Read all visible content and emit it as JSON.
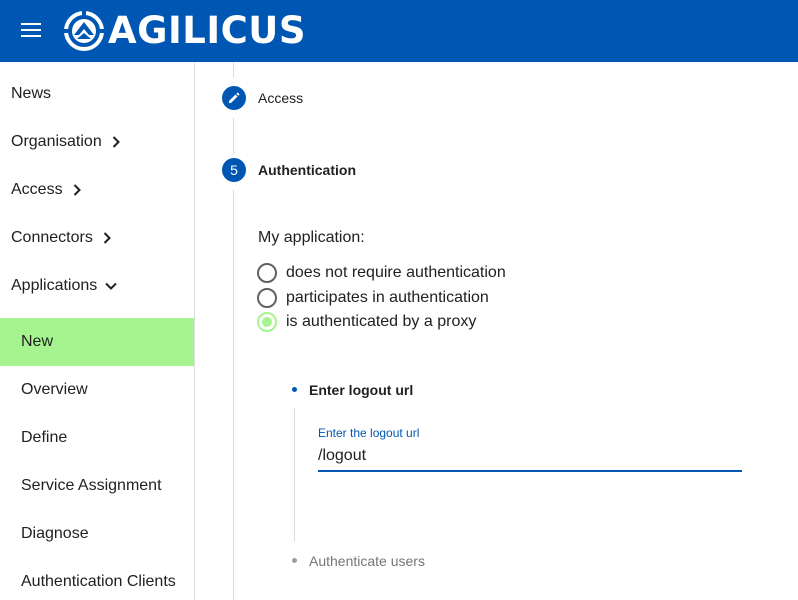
{
  "header": {
    "brand": "AGILICUS",
    "colors": {
      "bar": "#0057b3",
      "accent": "#a5f48f"
    }
  },
  "sidebar": {
    "items": [
      {
        "label": "News",
        "chevron": ""
      },
      {
        "label": "Organisation",
        "chevron": "chevron-right-icon"
      },
      {
        "label": "Access",
        "chevron": "chevron-right-icon"
      },
      {
        "label": "Connectors",
        "chevron": "chevron-right-icon"
      },
      {
        "label": "Applications",
        "chevron": "chevron-down-icon"
      },
      {
        "label": "New",
        "active": true
      },
      {
        "label": "Overview"
      },
      {
        "label": "Define"
      },
      {
        "label": "Service Assignment"
      },
      {
        "label": "Diagnose"
      },
      {
        "label": "Authentication Clients"
      }
    ]
  },
  "stepper": {
    "steps": [
      {
        "icon": "pencil-icon",
        "label": "Access"
      },
      {
        "number": "5",
        "label": "Authentication"
      }
    ]
  },
  "auth": {
    "question": "My application:",
    "options": [
      {
        "label": "does not require authentication",
        "checked": false
      },
      {
        "label": "participates in authentication",
        "checked": false
      },
      {
        "label": "is authenticated by a proxy",
        "checked": true
      }
    ]
  },
  "substeps": {
    "logout": {
      "title": "Enter logout url",
      "field_label": "Enter the logout url",
      "field_value": "/logout"
    },
    "next": {
      "title": "Authenticate users"
    }
  }
}
